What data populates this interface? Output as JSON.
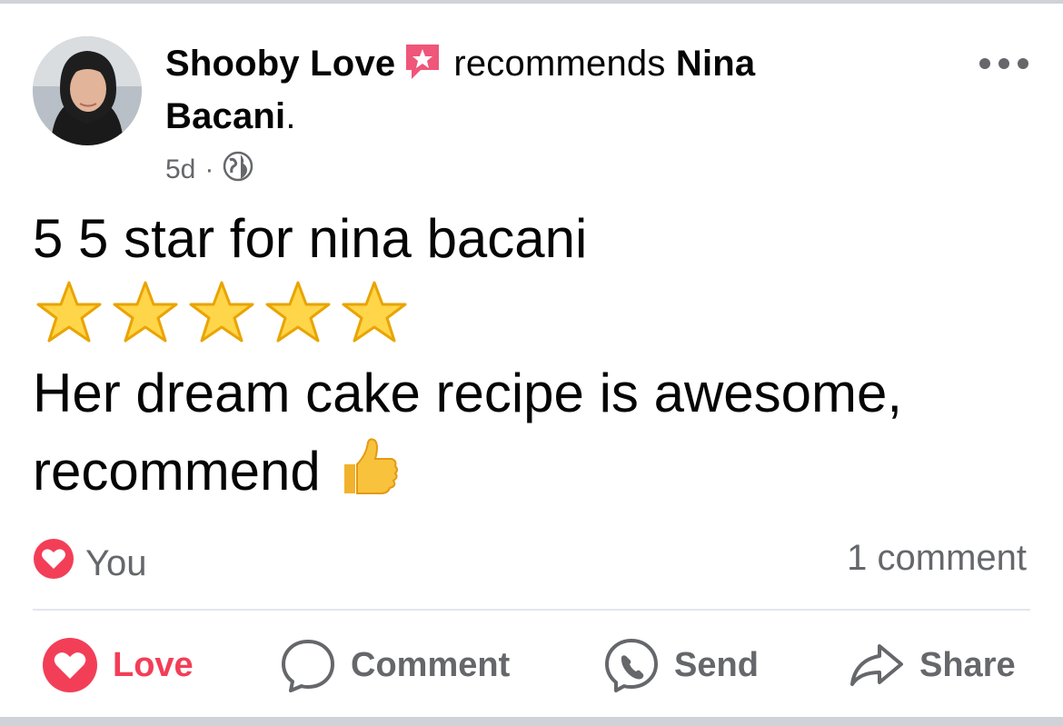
{
  "post": {
    "author": "Shooby Love",
    "verb": "recommends",
    "target_line1": "Nina",
    "target_line2": "Bacani",
    "target_end": ".",
    "time": "5d",
    "separator": "·",
    "text_line1": "5 5 star for nina bacani",
    "text_line3": "Her dream cake recipe is awesome,",
    "text_line4": "recommend",
    "star_count": 5,
    "thumbs_emoji": "👍"
  },
  "reactions": {
    "label": "You",
    "comments": "1 comment"
  },
  "actions": {
    "love": "Love",
    "comment": "Comment",
    "send": "Send",
    "share": "Share"
  },
  "colors": {
    "love": "#f33e58",
    "muted": "#65676b",
    "badge": "#f0557a"
  },
  "icons": {
    "avatar": "profile-photo",
    "badge": "star-recommendation-badge",
    "privacy": "globe-icon",
    "more": "more-dots-icon",
    "heart": "heart-icon",
    "comment": "comment-bubble-icon",
    "send": "messenger-icon",
    "share": "share-arrow-icon"
  }
}
